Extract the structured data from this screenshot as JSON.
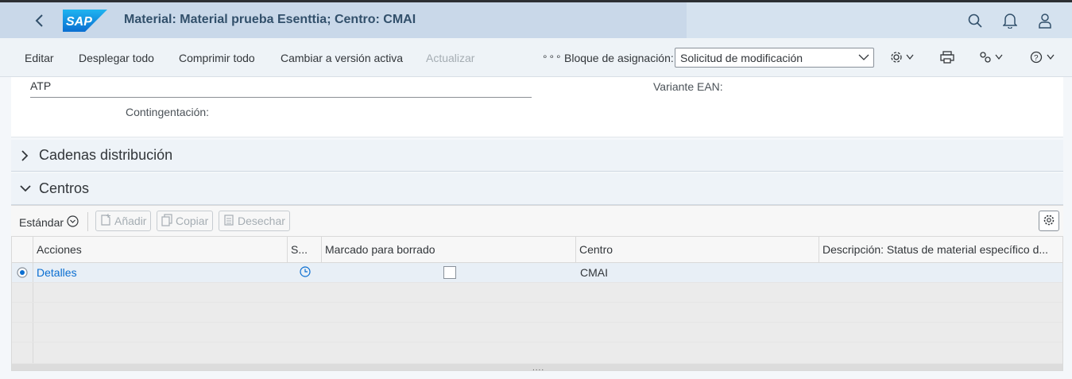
{
  "shell": {
    "title": "Material: Material prueba Esenttia; Centro: CMAI",
    "logo_text": "SAP",
    "icons": [
      "back-icon",
      "search-icon",
      "notification-icon",
      "user-icon"
    ]
  },
  "toolbar": {
    "buttons": [
      "Editar",
      "Desplegar todo",
      "Comprimir todo",
      "Cambiar a versión activa",
      "Actualizar"
    ],
    "more": "∘∘∘",
    "assignment_label": "Bloque de asignación:",
    "assignment_value": "Solicitud de modificación",
    "icons": [
      "settings-icon",
      "print-icon",
      "personalize-icon",
      "help-icon"
    ]
  },
  "form": {
    "atp": "ATP",
    "contingentacion_label": "Contingentación:",
    "variante_ean_label": "Variante EAN:"
  },
  "sections": {
    "cadenas": "Cadenas distribución",
    "centros": "Centros"
  },
  "table_toolbar": {
    "variant": "Estándar",
    "add": "Añadir",
    "copy": "Copiar",
    "discard": "Desechar"
  },
  "table": {
    "columns": [
      "Acciones",
      "S...",
      "Marcado para borrado",
      "Centro",
      "Descripción: Status de material específico d..."
    ],
    "rows": [
      {
        "acciones": "Detalles",
        "centro": "CMAI",
        "status_icon": "clock-icon",
        "marcado": false
      }
    ],
    "scroll_grip": "....",
    "colors": {
      "link": "#0a6ed1",
      "shell": "#c9d8e9"
    }
  }
}
